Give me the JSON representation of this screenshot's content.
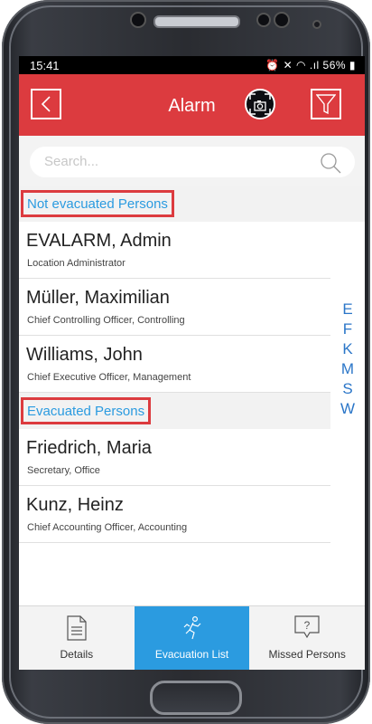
{
  "status": {
    "time": "15:41",
    "indicators": "56%"
  },
  "header": {
    "title": "Alarm"
  },
  "search": {
    "placeholder": "Search..."
  },
  "sections": [
    {
      "label": "Not evacuated Persons",
      "people": [
        {
          "name": "EVALARM, Admin",
          "role": "Location Administrator"
        },
        {
          "name": "Müller, Maximilian",
          "role": "Chief Controlling Officer, Controlling"
        },
        {
          "name": "Williams, John",
          "role": "Chief Executive Officer, Management"
        }
      ]
    },
    {
      "label": "Evacuated Persons",
      "people": [
        {
          "name": "Friedrich, Maria",
          "role": "Secretary, Office"
        },
        {
          "name": "Kunz, Heinz",
          "role": "Chief Accounting Officer, Accounting"
        }
      ]
    }
  ],
  "index_letters": [
    "E",
    "F",
    "K",
    "M",
    "S",
    "W"
  ],
  "tabs": [
    {
      "label": "Details",
      "icon": "document-icon",
      "active": false
    },
    {
      "label": "Evacuation List",
      "icon": "running-person-icon",
      "active": true
    },
    {
      "label": "Missed Persons",
      "icon": "question-box-icon",
      "active": false
    }
  ],
  "colors": {
    "accent_red": "#dc3b3f",
    "accent_blue": "#2b9be0"
  }
}
